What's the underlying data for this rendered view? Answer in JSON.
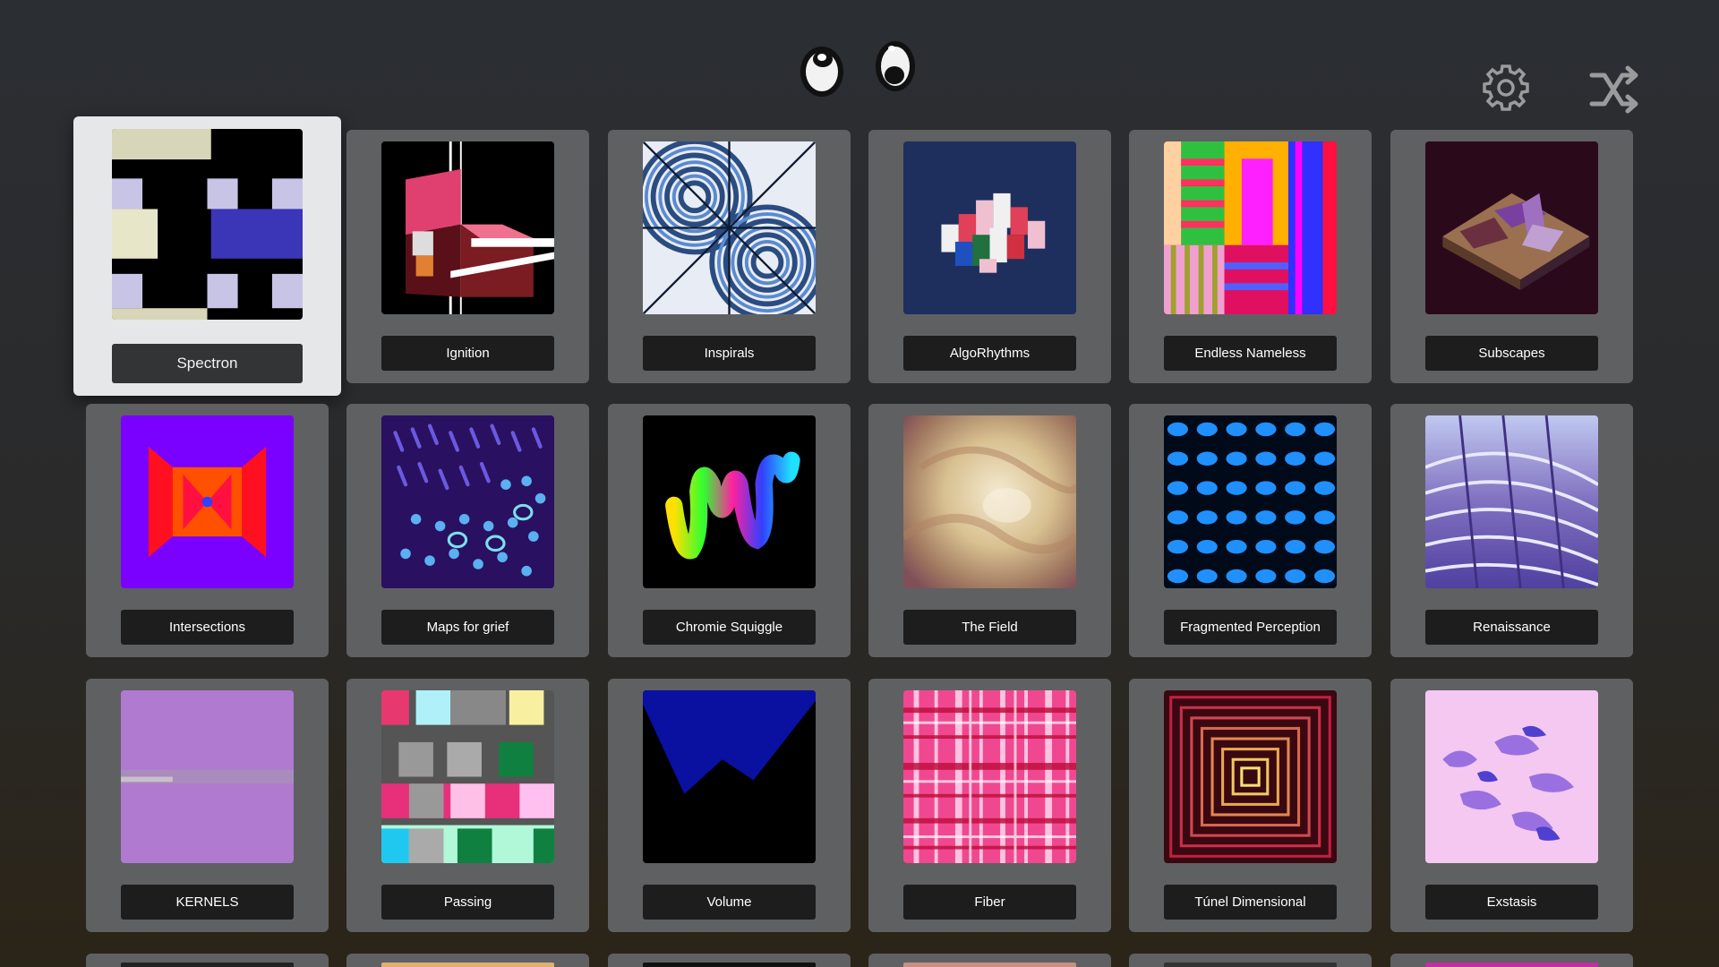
{
  "header": {
    "icons": {
      "eyes": "googly-eyes-icon",
      "settings": "gear-icon",
      "shuffle": "shuffle-icon"
    }
  },
  "tiles": [
    {
      "label": "Spectron",
      "selected": true
    },
    {
      "label": "Ignition"
    },
    {
      "label": "Inspirals"
    },
    {
      "label": "AlgoRhythms"
    },
    {
      "label": "Endless Nameless"
    },
    {
      "label": "Subscapes"
    },
    {
      "label": "Intersections"
    },
    {
      "label": "Maps for grief"
    },
    {
      "label": "Chromie Squiggle"
    },
    {
      "label": "The Field"
    },
    {
      "label": "Fragmented Perception"
    },
    {
      "label": "Renaissance"
    },
    {
      "label": "KERNELS"
    },
    {
      "label": "Passing"
    },
    {
      "label": "Volume"
    },
    {
      "label": "Fiber"
    },
    {
      "label": "Túnel Dimensional"
    },
    {
      "label": "Exstasis"
    }
  ],
  "colors": {
    "tile": "#5f6062",
    "tile_selected": "#e6e7e9",
    "label_bg": "#1d1d1e"
  }
}
